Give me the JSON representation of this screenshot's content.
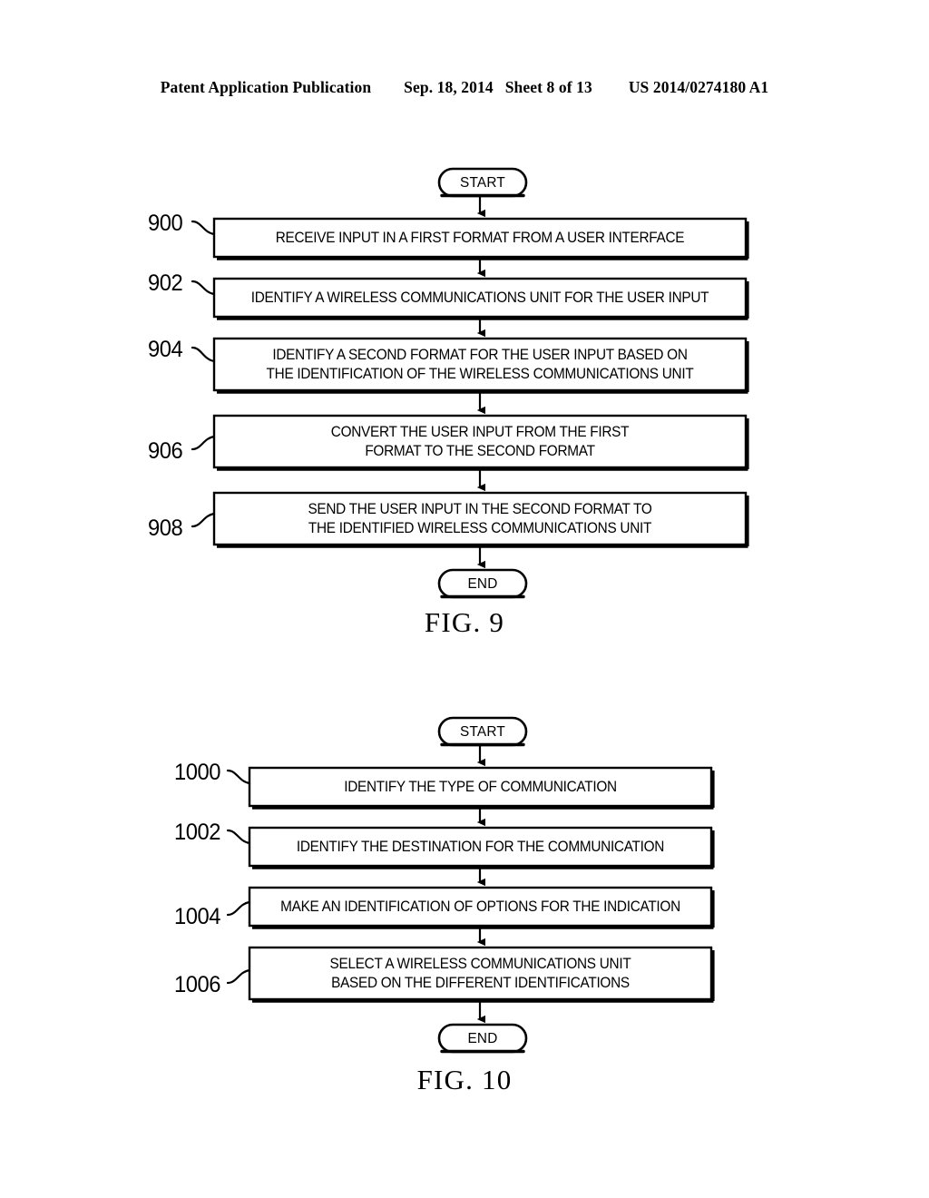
{
  "header": {
    "publication": "Patent Application Publication",
    "date": "Sep. 18, 2014",
    "sheet": "Sheet 8 of 13",
    "number": "US 2014/0274180 A1"
  },
  "figures": [
    {
      "id": "fig9",
      "caption": "FIG. 9",
      "start_label": "START",
      "end_label": "END",
      "steps": [
        {
          "ref": "900",
          "lines": [
            "RECEIVE INPUT IN A FIRST FORMAT FROM A USER INTERFACE"
          ]
        },
        {
          "ref": "902",
          "lines": [
            "IDENTIFY A WIRELESS COMMUNICATIONS UNIT FOR THE USER INPUT"
          ]
        },
        {
          "ref": "904",
          "lines": [
            "IDENTIFY A SECOND FORMAT FOR THE USER INPUT BASED ON",
            "THE IDENTIFICATION OF THE WIRELESS COMMUNICATIONS UNIT"
          ]
        },
        {
          "ref": "906",
          "lines": [
            "CONVERT THE USER INPUT FROM THE FIRST",
            "FORMAT TO THE SECOND FORMAT"
          ]
        },
        {
          "ref": "908",
          "lines": [
            "SEND THE USER INPUT IN THE SECOND FORMAT TO",
            "THE IDENTIFIED WIRELESS COMMUNICATIONS UNIT"
          ]
        }
      ]
    },
    {
      "id": "fig10",
      "caption": "FIG. 10",
      "start_label": "START",
      "end_label": "END",
      "steps": [
        {
          "ref": "1000",
          "lines": [
            "IDENTIFY THE TYPE OF COMMUNICATION"
          ]
        },
        {
          "ref": "1002",
          "lines": [
            "IDENTIFY THE DESTINATION FOR THE COMMUNICATION"
          ]
        },
        {
          "ref": "1004",
          "lines": [
            "MAKE AN IDENTIFICATION OF OPTIONS FOR THE INDICATION"
          ]
        },
        {
          "ref": "1006",
          "lines": [
            "SELECT A WIRELESS COMMUNICATIONS UNIT",
            "BASED ON THE DIFFERENT IDENTIFICATIONS"
          ]
        }
      ]
    }
  ],
  "colors": {
    "ink": "#000000",
    "paper": "#ffffff"
  }
}
